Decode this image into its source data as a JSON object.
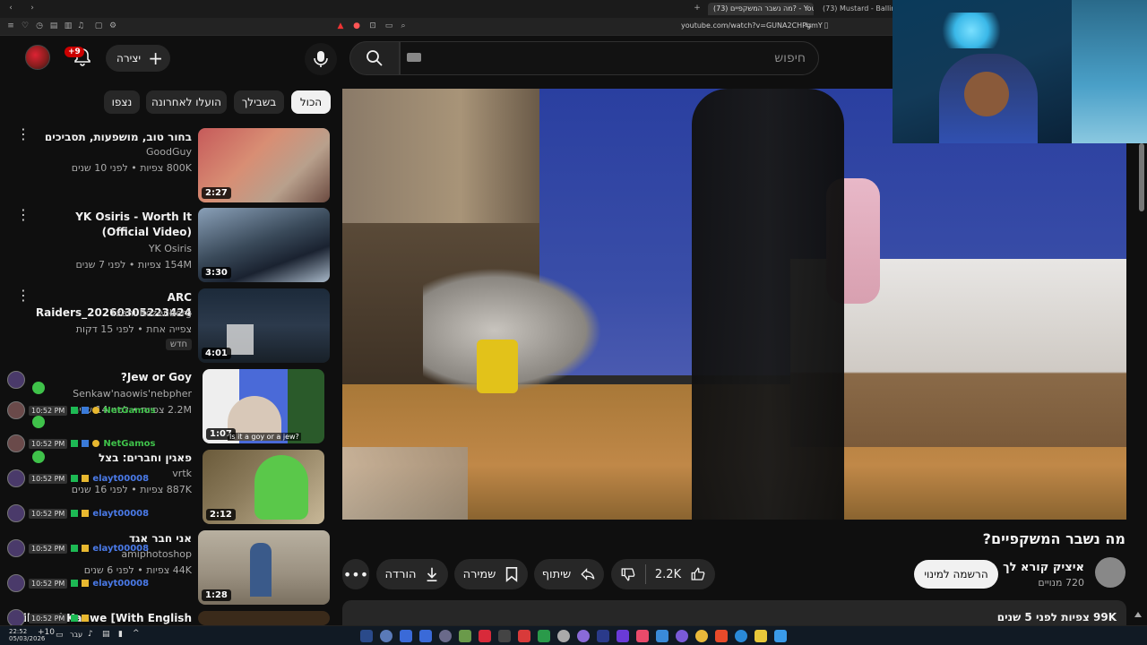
{
  "browser": {
    "tabs": [
      {
        "label": "(73) מה נשבר המשקפיים? - YouTube",
        "active": true
      },
      {
        "label": "(73) Mustard - Ballin' ft. Roddy Ricch",
        "active": false
      }
    ],
    "url": "youtube.com/watch?v=GUNA2CHPgmY"
  },
  "header": {
    "notification_count": "+9",
    "create_label": "יצירה",
    "search_placeholder": "חיפוש"
  },
  "chips": [
    "הכול",
    "בשבילך",
    "הועלו לאחרונה",
    "נצפו"
  ],
  "recommendations": [
    {
      "title": "בחור טוב, מושפעות, תסביכים",
      "channel": "GoodGuy",
      "meta": "800K צפיות • לפני 10 שנים",
      "duration": "2:27"
    },
    {
      "title": "YK Osiris - Worth It (Official Video)",
      "channel": "YK Osiris",
      "meta": "154M צפיות • לפני 7 שנים",
      "duration": "3:30"
    },
    {
      "title": "ARC Raiders_20260305223424",
      "channel": "Tzahi Rozenberg",
      "meta": "צפייה אחת • לפני 15 דקות",
      "duration": "4:01",
      "badge": "חדש"
    },
    {
      "title": "Jew or Goy?",
      "channel": "Senkaw'naowis'nebpher",
      "meta": "2.2M צפיות • לפני 14 שנים",
      "duration": "1:07",
      "caption": "Is it a goy or a jew?"
    },
    {
      "title": "פאגין וחברים: בצל",
      "channel": "vrtk",
      "meta": "887K צפיות • לפני 16 שנים",
      "duration": "2:12"
    },
    {
      "title": "אני חבר אגד",
      "channel": "amiphotoshop",
      "meta": "44K צפיות • לפני 6 שנים",
      "duration": "1:28"
    },
    {
      "title": "Chile – Al Kanwe [With English",
      "channel": "",
      "meta": "",
      "duration": ""
    }
  ],
  "chat": [
    {
      "time": "10:52 PM",
      "user": "NetGamos"
    },
    {
      "time": "10:52 PM",
      "user": "NetGamos"
    },
    {
      "time": "10:52 PM",
      "user": "elayt00008"
    },
    {
      "time": "10:52 PM",
      "user": "elayt00008"
    },
    {
      "time": "10:52 PM",
      "user": "elayt00008"
    },
    {
      "time": "10:52 PM",
      "user": "elayt00008"
    },
    {
      "time": "10:52 PM",
      "user": "elayt00008"
    }
  ],
  "video": {
    "title": "מה נשבר המשקפיים?",
    "channel_name": "איציק קורא לך",
    "subscribers": "720 מנויים",
    "subscribe_label": "הרשמה למינוי",
    "likes": "2.2K",
    "share_label": "שיתוף",
    "save_label": "שמירה",
    "download_label": "הורדה",
    "views_age": "99K צפיות  לפני 5 שנים"
  },
  "taskbar": {
    "time": "22:52",
    "date": "05/03/2026",
    "temp": "+10",
    "lang": "עבר"
  }
}
